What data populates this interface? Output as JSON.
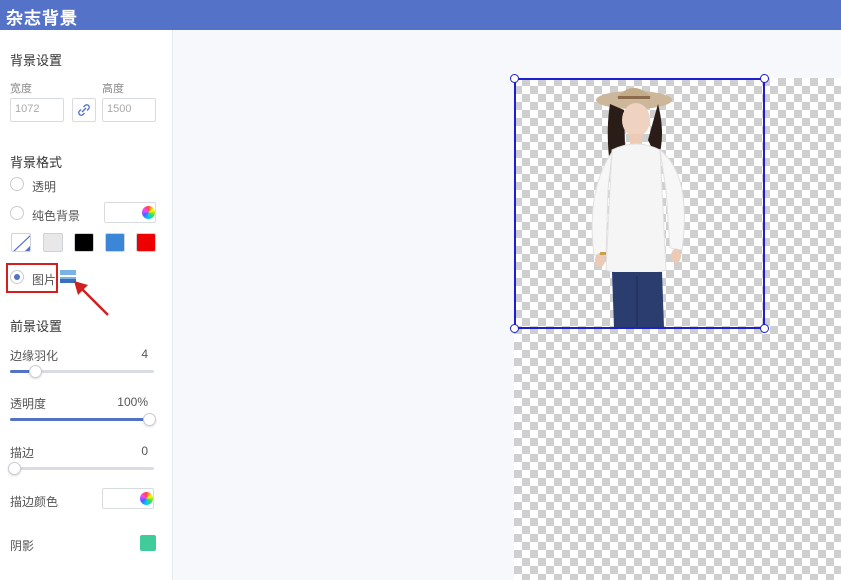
{
  "app": {
    "title": "杂志背景"
  },
  "background_settings": {
    "section_title": "背景设置",
    "width_label": "宽度",
    "height_label": "高度",
    "width_placeholder": "1072",
    "height_placeholder": "1500"
  },
  "background_format": {
    "section_title": "背景格式",
    "options": {
      "transparent": "透明",
      "solid": "纯色背景",
      "image": "图片"
    },
    "selected": "图片",
    "swatch_colors": [
      "#e8e8e8",
      "#000000",
      "#3b86d6",
      "#ee0000"
    ]
  },
  "foreground_settings": {
    "section_title": "前景设置",
    "feather": {
      "label": "边缘羽化",
      "value": "4",
      "fraction": 0.18
    },
    "opacity": {
      "label": "透明度",
      "value": "100%",
      "fraction": 1.0
    },
    "stroke": {
      "label": "描边",
      "value": "0",
      "fraction": 0.0
    },
    "stroke_color_label": "描边颜色",
    "shadow_label": "阴影",
    "shadow_color": "#3fcc9a"
  },
  "colors": {
    "accent": "#5472c8",
    "highlight": "#d02020",
    "selection": "#1d1fd0"
  }
}
